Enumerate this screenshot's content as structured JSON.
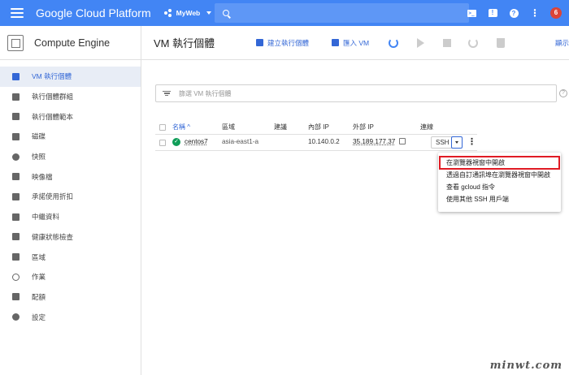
{
  "topbar": {
    "brand": "Google Cloud Platform",
    "project": "MyWeb",
    "notification_count": "6",
    "accent": "#4285f4",
    "icons": [
      "menu-icon",
      "project-dots-icon",
      "search-icon",
      "terminal-icon",
      "feedback-icon",
      "help-icon",
      "more-vert-icon",
      "notifications-icon"
    ]
  },
  "sidebar": {
    "product": "Compute Engine",
    "items": [
      {
        "label": "VM 執行個體",
        "icon": "vm-icon",
        "active": true
      },
      {
        "label": "執行個體群組",
        "icon": "instance-groups-icon"
      },
      {
        "label": "執行個體範本",
        "icon": "template-icon"
      },
      {
        "label": "磁碟",
        "icon": "disk-icon"
      },
      {
        "label": "快照",
        "icon": "snapshot-icon"
      },
      {
        "label": "映像檔",
        "icon": "image-icon"
      },
      {
        "label": "承諾使用折扣",
        "icon": "discount-icon"
      },
      {
        "label": "中繼資料",
        "icon": "metadata-icon"
      },
      {
        "label": "健康狀態檢查",
        "icon": "health-check-icon"
      },
      {
        "label": "區域",
        "icon": "zones-icon"
      },
      {
        "label": "作業",
        "icon": "operations-icon"
      },
      {
        "label": "配額",
        "icon": "quotas-icon"
      },
      {
        "label": "設定",
        "icon": "settings-icon"
      }
    ]
  },
  "toolbar": {
    "title": "VM 執行個體",
    "create_label": "建立執行個體",
    "import_label": "匯入 VM",
    "more_label": "顯示"
  },
  "filter": {
    "placeholder": "篩選 VM 執行個體"
  },
  "table": {
    "headers": {
      "name": "名稱 ^",
      "zone": "區域",
      "recommendation": "建議",
      "internal_ip": "內部 IP",
      "external_ip": "外部 IP",
      "connect": "連線"
    },
    "rows": [
      {
        "name": "centos7",
        "zone": "asia-east1-a",
        "internal_ip": "10.140.0.2",
        "external_ip": "35.189.177.37",
        "ssh_label": "SSH",
        "status": "running"
      }
    ]
  },
  "ssh_menu": {
    "items": [
      "在瀏覽器視窗中開啟",
      "透過自訂通訊埠在瀏覽器視窗中開啟",
      "查看 gcloud 指令",
      "使用其他 SSH 用戶端"
    ],
    "highlight_color": "#e01b24"
  },
  "watermark": "minwt.com"
}
